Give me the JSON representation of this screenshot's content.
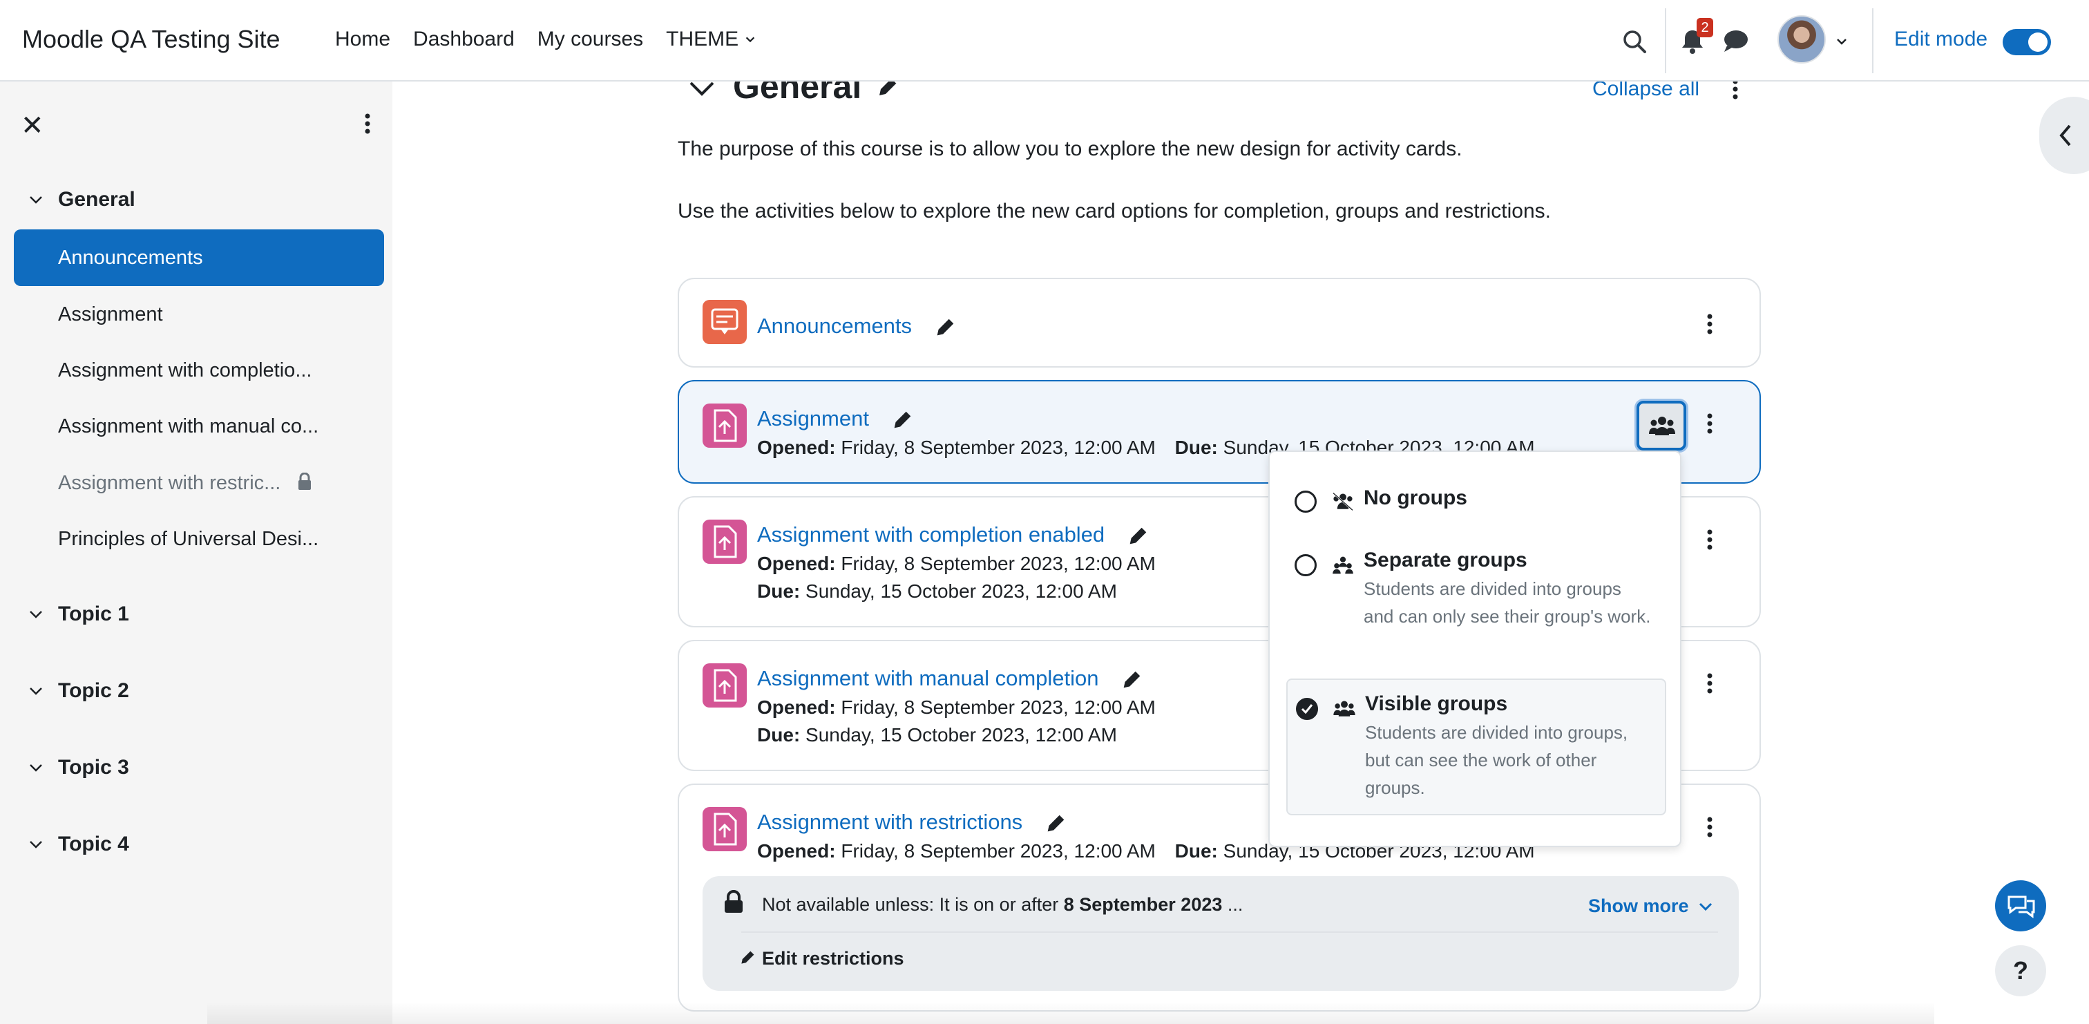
{
  "navbar": {
    "site_name": "Moodle QA Testing Site",
    "links": [
      "Home",
      "Dashboard",
      "My courses",
      "THEME"
    ],
    "notification_count": "2",
    "edit_mode_label": "Edit mode",
    "edit_mode_on": true,
    "icons": [
      "search-icon",
      "bell-icon",
      "chat-icon",
      "avatar",
      "chevron-down-icon"
    ]
  },
  "drawer": {
    "sections": [
      {
        "title": "General",
        "expanded": true,
        "items": [
          {
            "label": "Announcements",
            "active": true
          },
          {
            "label": "Assignment"
          },
          {
            "label": "Assignment with completio..."
          },
          {
            "label": "Assignment with manual co..."
          },
          {
            "label": "Assignment with restric...",
            "locked": true
          },
          {
            "label": "Principles of Universal Desi..."
          }
        ]
      },
      {
        "title": "Topic 1"
      },
      {
        "title": "Topic 2"
      },
      {
        "title": "Topic 3"
      },
      {
        "title": "Topic 4"
      }
    ]
  },
  "section": {
    "title": "General",
    "collapse_all": "Collapse all",
    "summary": [
      "The purpose of this course is to allow you to explore the new design for activity cards.",
      "Use the activities below to explore the new card options for completion, groups and restrictions."
    ]
  },
  "activities": [
    {
      "title": "Announcements",
      "type": "forum"
    },
    {
      "title": "Assignment",
      "type": "assign",
      "opened_label": "Opened:",
      "opened": "Friday, 8 September 2023, 12:00 AM",
      "due_label": "Due:",
      "due": "Sunday, 15 October 2023, 12:00 AM"
    },
    {
      "title": "Assignment with completion enabled",
      "type": "assign",
      "opened_label": "Opened:",
      "opened": "Friday, 8 September 2023, 12:00 AM",
      "due_label": "Due:",
      "due": "Sunday, 15 October 2023, 12:00 AM"
    },
    {
      "title": "Assignment with manual completion",
      "type": "assign",
      "opened_label": "Opened:",
      "opened": "Friday, 8 September 2023, 12:00 AM",
      "due_label": "Due:",
      "due": "Sunday, 15 October 2023, 12:00 AM"
    },
    {
      "title": "Assignment with restrictions",
      "type": "assign",
      "opened_label": "Opened:",
      "opened": "Friday, 8 September 2023, 12:00 AM",
      "due_label": "Due:",
      "due": "Sunday, 15 October 2023, 12:00 AM",
      "restriction": {
        "prefix": "Not available unless: It is on or after ",
        "date": "8 September 2023",
        "suffix": " ...",
        "show_more": "Show more",
        "edit": "Edit restrictions"
      }
    }
  ],
  "group_menu": {
    "options": [
      {
        "title": "No groups",
        "desc": "",
        "selected": false
      },
      {
        "title": "Separate groups",
        "desc": "Students are divided into groups and can only see their group's work.",
        "selected": false
      },
      {
        "title": "Visible groups",
        "desc": "Students are divided into groups, but can see the work of other groups.",
        "selected": true
      }
    ]
  },
  "help_label": "?",
  "colors": {
    "brand": "#0f6cbf",
    "forum": "#e8674a",
    "assign": "#d45595",
    "drawer_bg": "#f5f5f5"
  }
}
